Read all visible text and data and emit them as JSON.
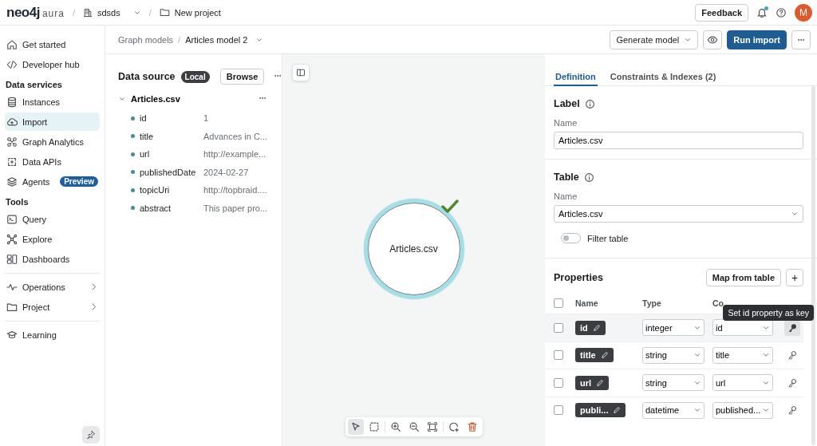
{
  "topbar": {
    "logo_text": "neo4j",
    "logo_suffix": "aura",
    "separator": "/",
    "breadcrumbs": [
      {
        "label": "sdsds",
        "kind": "org"
      },
      {
        "label": "New project",
        "kind": "project"
      }
    ],
    "feedback": "Feedback",
    "has_notification": true,
    "avatar": "M"
  },
  "sidebar": {
    "groups": [
      {
        "divider": false,
        "items": [
          {
            "label": "Get started",
            "kind": "link",
            "selected": false
          },
          {
            "label": "Developer hub",
            "kind": "link",
            "selected": false
          }
        ]
      },
      {
        "heading": "Data services",
        "divider": false,
        "items": [
          {
            "label": "Instances",
            "kind": "link",
            "selected": false
          },
          {
            "label": "Import",
            "kind": "link",
            "selected": true
          },
          {
            "label": "Graph Analytics",
            "kind": "link",
            "selected": false
          },
          {
            "label": "Data APIs",
            "kind": "link",
            "selected": false
          },
          {
            "label": "Agents",
            "kind": "link",
            "selected": false,
            "badge": "Preview"
          }
        ]
      },
      {
        "heading": "Tools",
        "divider": false,
        "items": [
          {
            "label": "Query",
            "kind": "link",
            "selected": false
          },
          {
            "label": "Explore",
            "kind": "link",
            "selected": false
          },
          {
            "label": "Dashboards",
            "kind": "link",
            "selected": false
          }
        ]
      },
      {
        "divider": true,
        "items": [
          {
            "label": "Operations",
            "kind": "menu",
            "selected": false
          },
          {
            "label": "Project",
            "kind": "menu",
            "selected": false
          }
        ]
      },
      {
        "divider": true,
        "items": [
          {
            "label": "Learning",
            "kind": "link",
            "selected": false
          }
        ]
      }
    ]
  },
  "subheader": {
    "separator": "/",
    "breadcrumbs": [
      "Graph models",
      "Articles model 2"
    ],
    "generate_button": "Generate model",
    "run_button": "Run import"
  },
  "data_source": {
    "title": "Data source",
    "badge": "Local",
    "browse_button": "Browse",
    "file": {
      "name": "Articles.csv",
      "expanded": true,
      "fields": [
        {
          "name": "id",
          "sample": "1"
        },
        {
          "name": "title",
          "sample": "Advances in C..."
        },
        {
          "name": "url",
          "sample": "http://example..."
        },
        {
          "name": "publishedDate",
          "sample": "2024-02-27"
        },
        {
          "name": "topicUri",
          "sample": "http://topbraid...."
        },
        {
          "name": "abstract",
          "sample": "This paper pro..."
        }
      ]
    }
  },
  "canvas": {
    "node": {
      "label": "Articles.csv",
      "selected": true,
      "valid": true
    },
    "tools": [
      {
        "kind": "select",
        "selected": true
      },
      {
        "kind": "box-select",
        "selected": false
      },
      {
        "kind": "zoom-in",
        "selected": false
      },
      {
        "kind": "zoom-out",
        "selected": false
      },
      {
        "kind": "fit",
        "selected": false
      },
      {
        "kind": "add-node",
        "selected": false
      },
      {
        "kind": "delete",
        "selected": false
      }
    ]
  },
  "inspector": {
    "tabs": [
      {
        "label": "Definition",
        "selected": true
      },
      {
        "label": "Constraints & Indexes (2)",
        "selected": false
      }
    ],
    "label_section": {
      "heading": "Label",
      "field_label": "Name",
      "value": "Articles.csv"
    },
    "table_section": {
      "heading": "Table",
      "field_label": "Name",
      "value": "Articles.csv",
      "filter": {
        "label": "Filter table",
        "on": false
      }
    },
    "properties": {
      "heading": "Properties",
      "map_button": "Map from table",
      "add_button": "+",
      "all_checked": false,
      "columns": [
        "Name",
        "Type",
        "Co"
      ],
      "tooltip": "Set id property as key",
      "rows": [
        {
          "name": "id",
          "type": "integer",
          "column": "id",
          "checked": false,
          "hovered": true
        },
        {
          "name": "title",
          "type": "string",
          "column": "title",
          "checked": false,
          "hovered": false
        },
        {
          "name": "url",
          "type": "string",
          "column": "url",
          "checked": false,
          "hovered": false
        },
        {
          "name": "publi...",
          "type": "datetime",
          "column": "published...",
          "checked": false,
          "hovered": false
        }
      ]
    }
  }
}
